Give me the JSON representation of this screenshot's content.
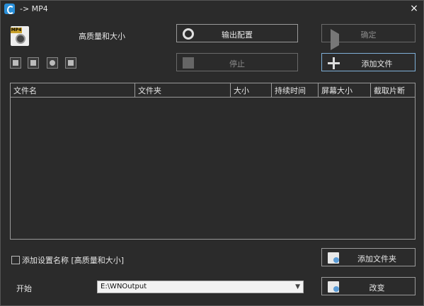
{
  "window": {
    "title": "-> MP4",
    "close": "×"
  },
  "preset": {
    "name": "高质量和大小",
    "icon_tag": "MP4"
  },
  "buttons": {
    "output_config": "输出配置",
    "confirm": "确定",
    "stop": "停止",
    "add_file": "添加文件",
    "add_folder": "添加文件夹",
    "change": "改变"
  },
  "table": {
    "columns": [
      "文件名",
      "文件夹",
      "大小",
      "持续时间",
      "屏幕大小",
      "截取片断"
    ]
  },
  "options": {
    "add_preset_name": "添加设置名称 [高质量和大小]"
  },
  "output": {
    "start_label": "开始",
    "path": "E:\\WNOutput"
  },
  "icons": [
    "app-icon",
    "mp4-file-icon",
    "add-icon",
    "clip-icon",
    "play-icon",
    "list-icon",
    "gear-icon",
    "arrow-right-icon",
    "stop-icon",
    "plus-icon",
    "folder-icon",
    "folder-change-icon"
  ]
}
